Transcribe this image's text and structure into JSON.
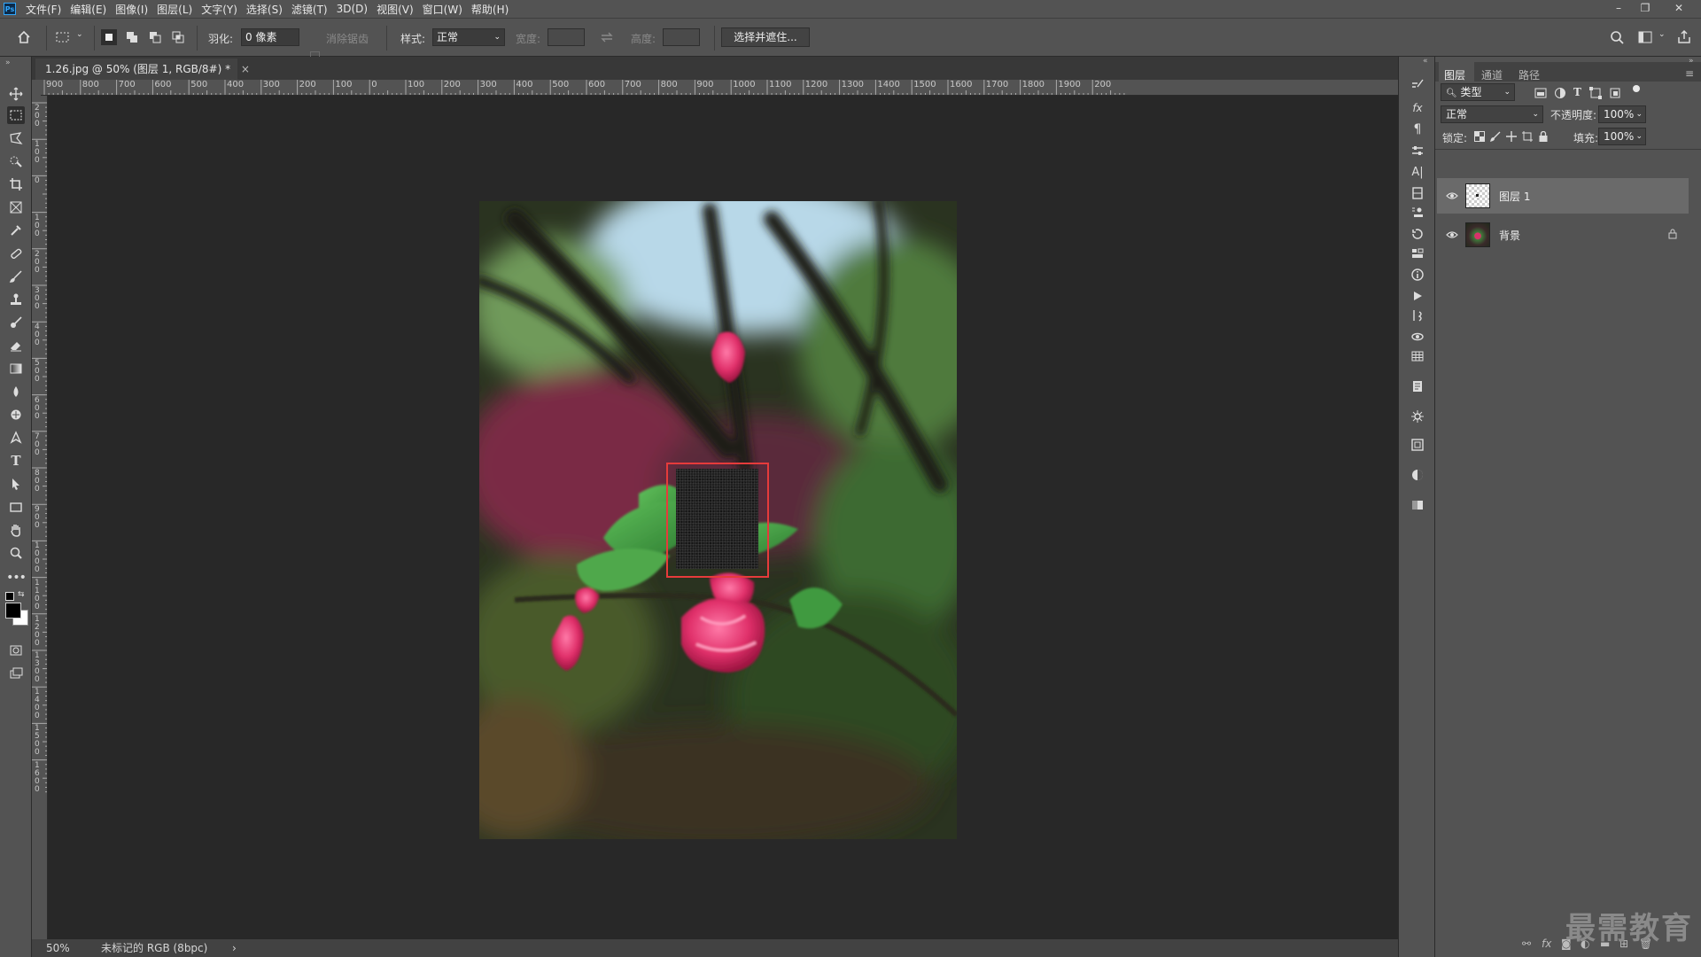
{
  "menubar": {
    "items": [
      "文件(F)",
      "编辑(E)",
      "图像(I)",
      "图层(L)",
      "文字(Y)",
      "选择(S)",
      "滤镜(T)",
      "3D(D)",
      "视图(V)",
      "窗口(W)",
      "帮助(H)"
    ]
  },
  "options": {
    "feather_label": "羽化:",
    "feather_value": "0 像素",
    "antialias_label": "消除锯齿",
    "style_label": "样式:",
    "style_value": "正常",
    "width_label": "宽度:",
    "height_label": "高度:",
    "select_mask_button": "选择并遮住..."
  },
  "document": {
    "tab_title": "1.26.jpg @ 50% (图层 1, RGB/8#) *",
    "close_glyph": "×"
  },
  "ruler": {
    "h_labels": [
      "900",
      "800",
      "700",
      "600",
      "500",
      "400",
      "300",
      "200",
      "100",
      "0",
      "100",
      "200",
      "300",
      "400",
      "500",
      "600",
      "700",
      "800",
      "900",
      "1000",
      "1100",
      "1200",
      "1300",
      "1400",
      "1500",
      "1600",
      "1700",
      "1800",
      "1900",
      "200"
    ],
    "v_labels": [
      "200",
      "100",
      "0",
      "100",
      "200",
      "300",
      "400",
      "500",
      "600",
      "700",
      "800",
      "900",
      "1000",
      "1100",
      "1200",
      "1300",
      "1400",
      "1500",
      "1600"
    ]
  },
  "statusbar": {
    "zoom": "50%",
    "info": "未标记的 RGB (8bpc)",
    "arrow": "›"
  },
  "layers_panel": {
    "tabs": [
      "图层",
      "通道",
      "路径"
    ],
    "filter_label": "类型",
    "blend_mode": "正常",
    "opacity_label": "不透明度:",
    "opacity_value": "100%",
    "lock_label": "锁定:",
    "fill_label": "填充:",
    "fill_value": "100%",
    "layers": [
      {
        "name": "图层 1",
        "selected": true,
        "locked": false
      },
      {
        "name": "背景",
        "selected": false,
        "locked": true
      }
    ]
  },
  "watermark": "最需教育",
  "colors": {
    "selection": "#e63b3b",
    "panel": "#535353",
    "canvas": "#282828"
  }
}
